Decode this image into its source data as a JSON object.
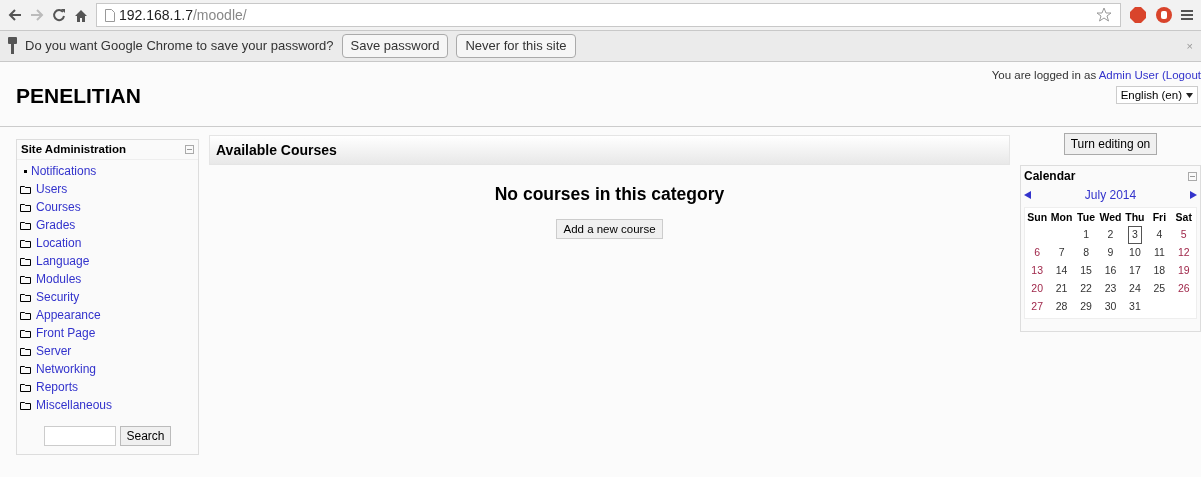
{
  "browser": {
    "url_host": "192.168.1.7",
    "url_path": "/moodle/"
  },
  "password_bar": {
    "message": "Do you want Google Chrome to save your password?",
    "buttons": [
      "Save password",
      "Never for this site"
    ],
    "close": "×"
  },
  "header": {
    "site_name": "PENELITIAN",
    "login_prefix": "You are logged in as",
    "user": "Admin User",
    "logout": "(Logout",
    "language": "English (en)"
  },
  "site_admin": {
    "title": "Site Administration",
    "items": [
      {
        "label": "Notifications",
        "kind": "leaf"
      },
      {
        "label": "Users",
        "kind": "folder"
      },
      {
        "label": "Courses",
        "kind": "folder"
      },
      {
        "label": "Grades",
        "kind": "folder"
      },
      {
        "label": "Location",
        "kind": "folder"
      },
      {
        "label": "Language",
        "kind": "folder"
      },
      {
        "label": "Modules",
        "kind": "folder"
      },
      {
        "label": "Security",
        "kind": "folder"
      },
      {
        "label": "Appearance",
        "kind": "folder"
      },
      {
        "label": "Front Page",
        "kind": "folder"
      },
      {
        "label": "Server",
        "kind": "folder"
      },
      {
        "label": "Networking",
        "kind": "folder"
      },
      {
        "label": "Reports",
        "kind": "folder"
      },
      {
        "label": "Miscellaneous",
        "kind": "folder"
      }
    ],
    "search_button": "Search"
  },
  "main": {
    "title": "Available Courses",
    "message": "No courses in this category",
    "button": "Add a new course"
  },
  "editing_button": "Turn editing on",
  "calendar": {
    "title": "Calendar",
    "month": "July 2014",
    "weekdays": [
      "Sun",
      "Mon",
      "Tue",
      "Wed",
      "Thu",
      "Fri",
      "Sat"
    ],
    "weeks": [
      {
        "kind": "partial_start",
        "days": [
          {
            "day": "1",
            "weekend": false,
            "selected": false
          },
          {
            "day": "2",
            "weekend": false,
            "selected": false
          },
          {
            "day": "3",
            "weekend": false,
            "selected": true
          },
          {
            "day": "4",
            "weekend": false,
            "selected": false
          },
          {
            "day": "5",
            "weekend": true,
            "selected": false
          }
        ]
      },
      {
        "kind": "full",
        "days": [
          {
            "day": "6",
            "weekend": true,
            "selected": false
          },
          {
            "day": "7",
            "weekend": false,
            "selected": false
          },
          {
            "day": "8",
            "weekend": false,
            "selected": false
          },
          {
            "day": "9",
            "weekend": false,
            "selected": false
          },
          {
            "day": "10",
            "weekend": false,
            "selected": false
          },
          {
            "day": "11",
            "weekend": false,
            "selected": false
          },
          {
            "day": "12",
            "weekend": true,
            "selected": false
          }
        ]
      },
      {
        "kind": "full",
        "days": [
          {
            "day": "13",
            "weekend": true,
            "selected": false
          },
          {
            "day": "14",
            "weekend": false,
            "selected": false
          },
          {
            "day": "15",
            "weekend": false,
            "selected": false
          },
          {
            "day": "16",
            "weekend": false,
            "selected": false
          },
          {
            "day": "17",
            "weekend": false,
            "selected": false
          },
          {
            "day": "18",
            "weekend": false,
            "selected": false
          },
          {
            "day": "19",
            "weekend": true,
            "selected": false
          }
        ]
      },
      {
        "kind": "full",
        "days": [
          {
            "day": "20",
            "weekend": true,
            "selected": false
          },
          {
            "day": "21",
            "weekend": false,
            "selected": false
          },
          {
            "day": "22",
            "weekend": false,
            "selected": false
          },
          {
            "day": "23",
            "weekend": false,
            "selected": false
          },
          {
            "day": "24",
            "weekend": false,
            "selected": false
          },
          {
            "day": "25",
            "weekend": false,
            "selected": false
          },
          {
            "day": "26",
            "weekend": true,
            "selected": false
          }
        ]
      },
      {
        "kind": "partial_end",
        "days": [
          {
            "day": "27",
            "weekend": true,
            "selected": false
          },
          {
            "day": "28",
            "weekend": false,
            "selected": false
          },
          {
            "day": "29",
            "weekend": false,
            "selected": false
          },
          {
            "day": "30",
            "weekend": false,
            "selected": false
          },
          {
            "day": "31",
            "weekend": false,
            "selected": false
          }
        ]
      }
    ]
  }
}
